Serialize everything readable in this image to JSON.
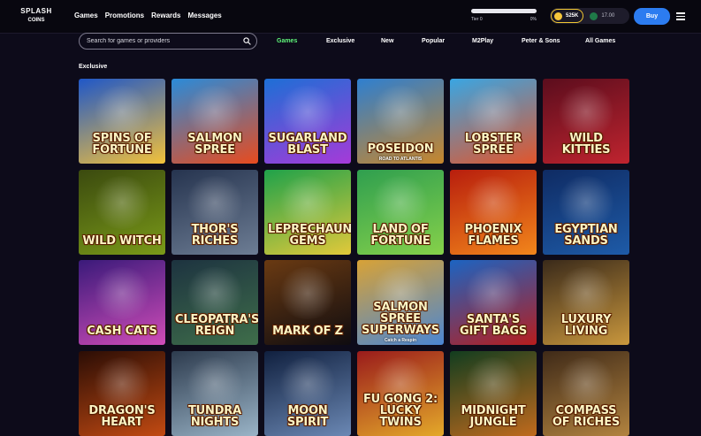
{
  "header": {
    "logo_line1": "SPLASH",
    "logo_line2": "COINS",
    "nav": [
      "Games",
      "Promotions",
      "Rewards",
      "Messages"
    ],
    "tier": {
      "left": "Tier 0",
      "right": "0%",
      "progress": 0.0
    },
    "gold_coins": "525K",
    "sweep_coins": "17.00",
    "buy_label": "Buy"
  },
  "search": {
    "placeholder": "Search for games or providers"
  },
  "tabs": [
    {
      "label": "Games",
      "active": true
    },
    {
      "label": "Exclusive",
      "active": false
    },
    {
      "label": "New",
      "active": false
    },
    {
      "label": "Popular",
      "active": false
    },
    {
      "label": "M2Play",
      "active": false
    },
    {
      "label": "Peter & Sons",
      "active": false
    },
    {
      "label": "All Games",
      "active": false
    }
  ],
  "section_title": "Exclusive",
  "games": [
    {
      "title": "Spins of Fortune",
      "sub": "",
      "bg": [
        "#1f57c8",
        "#f3c13a"
      ]
    },
    {
      "title": "Salmon Spree",
      "sub": "",
      "bg": [
        "#2a8bd9",
        "#e84b1e"
      ]
    },
    {
      "title": "Sugarland Blast",
      "sub": "",
      "bg": [
        "#1d6fd6",
        "#a53ad8"
      ]
    },
    {
      "title": "Poseidon",
      "sub": "ROAD TO ATLANTIS",
      "bg": [
        "#2e7fd0",
        "#c7862b"
      ]
    },
    {
      "title": "Lobster Spree",
      "sub": "",
      "bg": [
        "#39a6e3",
        "#e2552b"
      ]
    },
    {
      "title": "Wild Kitties",
      "sub": "",
      "bg": [
        "#5b0d1d",
        "#c0242f"
      ]
    },
    {
      "title": "Wild Witch",
      "sub": "",
      "bg": [
        "#3b4a0f",
        "#7a9a18"
      ]
    },
    {
      "title": "Thor's Riches",
      "sub": "",
      "bg": [
        "#26344f",
        "#6d7d94"
      ]
    },
    {
      "title": "Leprechaun's Gems",
      "sub": "",
      "bg": [
        "#1fa24a",
        "#e2c93a"
      ]
    },
    {
      "title": "Land of Fortune",
      "sub": "",
      "bg": [
        "#2f9f4f",
        "#86d14a"
      ]
    },
    {
      "title": "Phoenix Flames",
      "sub": "",
      "bg": [
        "#b81e0d",
        "#f2861b"
      ]
    },
    {
      "title": "Egyptian Sands",
      "sub": "",
      "bg": [
        "#0f2b63",
        "#1e5ba8"
      ]
    },
    {
      "title": "Cash Cats",
      "sub": "",
      "bg": [
        "#3a1a7a",
        "#d04cb8"
      ]
    },
    {
      "title": "Cleopatra's Reign",
      "sub": "",
      "bg": [
        "#1d3340",
        "#3f6e4a"
      ]
    },
    {
      "title": "Mark of Z",
      "sub": "",
      "bg": [
        "#6a3a12",
        "#0f0c10"
      ]
    },
    {
      "title": "Salmon Spree Superways",
      "sub": "Catch a Respin",
      "bg": [
        "#d8a236",
        "#4a86d3"
      ]
    },
    {
      "title": "Santa's Gift Bags",
      "sub": "",
      "bg": [
        "#1c64c2",
        "#b71d1d"
      ]
    },
    {
      "title": "Luxury Living",
      "sub": "",
      "bg": [
        "#3a2a1a",
        "#c9973d"
      ]
    },
    {
      "title": "Dragon's Heart",
      "sub": "",
      "bg": [
        "#2b0d05",
        "#c24a12"
      ]
    },
    {
      "title": "Tundra Nights",
      "sub": "",
      "bg": [
        "#2d3b4e",
        "#9ab4c7"
      ]
    },
    {
      "title": "Moon Spirit",
      "sub": "",
      "bg": [
        "#10203f",
        "#6b88b4"
      ]
    },
    {
      "title": "Fu Gong 2: Lucky Twins",
      "sub": "",
      "bg": [
        "#9a1b1b",
        "#e4a92a"
      ]
    },
    {
      "title": "Midnight Jungle",
      "sub": "",
      "bg": [
        "#123d1f",
        "#c06a1d"
      ]
    },
    {
      "title": "Compass of Riches",
      "sub": "",
      "bg": [
        "#3f2a18",
        "#b2833f"
      ]
    }
  ],
  "colors": {
    "background": "#0d0b1a",
    "active_tab": "#5ff77a",
    "buy_button": "#2c7cf0",
    "gold_coin": "#f5c63b"
  },
  "icons": [
    "search-icon",
    "gold-coin-icon",
    "sweep-coin-icon",
    "hamburger-menu-icon"
  ]
}
